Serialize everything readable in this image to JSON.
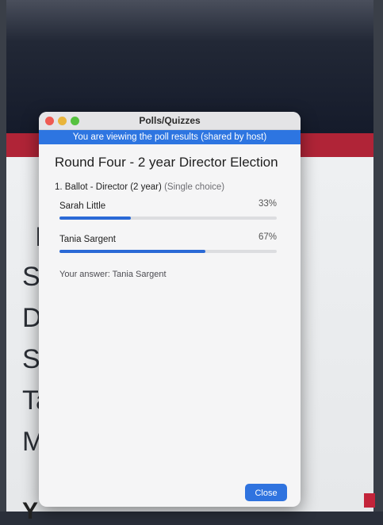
{
  "background": {
    "letters": [
      "I",
      "Sa",
      "D",
      "Sa",
      "Ta",
      "M"
    ],
    "bottom_text": "Y"
  },
  "window": {
    "title": "Polls/Quizzes",
    "banner": "You are viewing the poll results (shared by host)",
    "heading": "Round Four - 2 year Director Election",
    "question": {
      "label": "1. Ballot - Director (2 year)",
      "hint": "(Single choice)"
    },
    "options": [
      {
        "name": "Sarah Little",
        "percent_text": "33%",
        "percent": 33
      },
      {
        "name": "Tania Sargent",
        "percent_text": "67%",
        "percent": 67
      }
    ],
    "answer": "Your answer: Tania Sargent",
    "close_label": "Close"
  },
  "colors": {
    "accent": "#2d75e1",
    "bar_fill": "#2a69d6",
    "red_band": "#b02437"
  }
}
